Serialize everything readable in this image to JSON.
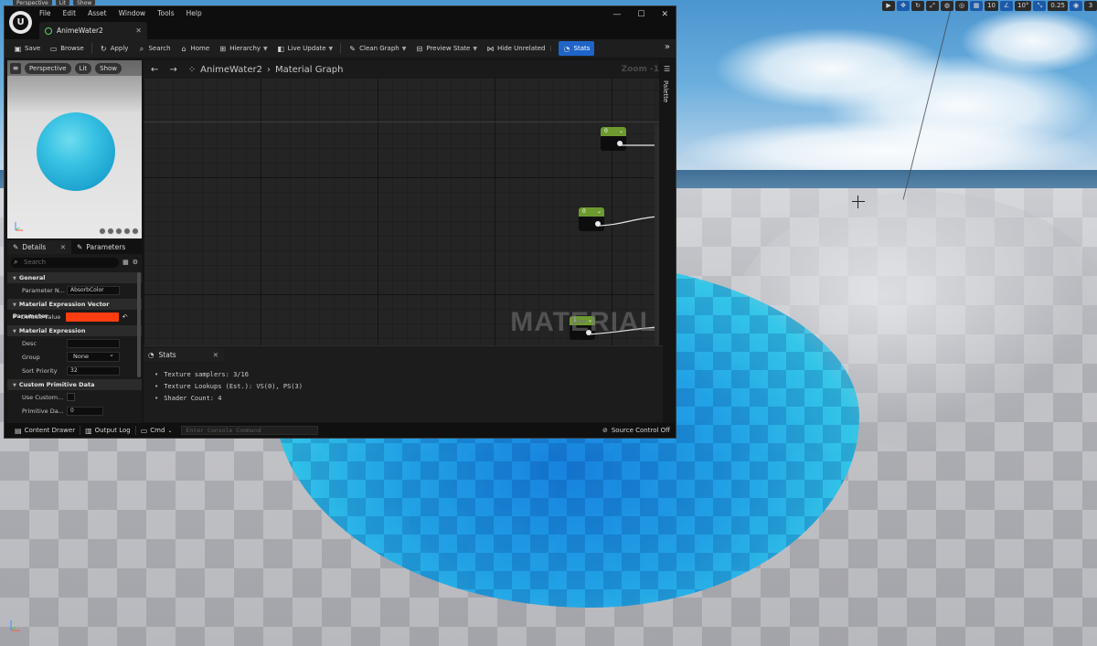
{
  "viewport": {
    "top_left_buttons": [
      "Perspective",
      "Lit",
      "Show"
    ],
    "top_right_buttons": [
      "10",
      "10°",
      "0.25",
      "3"
    ]
  },
  "editor": {
    "menu": [
      "File",
      "Edit",
      "Asset",
      "Window",
      "Tools",
      "Help"
    ],
    "doc_tab": "AnimeWater2",
    "window_controls": [
      "—",
      "☐",
      "✕"
    ],
    "toolbar": {
      "save": "Save",
      "browse": "Browse",
      "apply": "Apply",
      "search": "Search",
      "home": "Home",
      "hierarchy": "Hierarchy",
      "live_update": "Live Update",
      "clean_graph": "Clean Graph",
      "preview_state": "Preview State",
      "hide_unrelated": "Hide Unrelated",
      "stats": "Stats"
    },
    "preview": {
      "buttons": [
        "Perspective",
        "Lit",
        "Show"
      ]
    },
    "details": {
      "tab_details": "Details",
      "tab_parameters": "Parameters",
      "search_placeholder": "Search",
      "sections": {
        "general": "General",
        "vector_param": "Material Expression Vector Parameter",
        "expression": "Material Expression",
        "custom_primitive": "Custom Primitive Data"
      },
      "rows": {
        "parameter_name_label": "Parameter N...",
        "parameter_name_value": "AbsorbColor",
        "default_value_label": "Default Value",
        "desc_label": "Desc",
        "group_label": "Group",
        "group_value": "None",
        "sort_priority_label": "Sort Priority",
        "sort_priority_value": "32",
        "use_custom_label": "Use Custom...",
        "primitive_data_label": "Primitive Da...",
        "primitive_data_value": "0"
      },
      "default_color": "#ff3d10"
    },
    "graph": {
      "breadcrumb_asset": "AnimeWater2",
      "breadcrumb_graph": "Material Graph",
      "zoom": "Zoom -1",
      "watermark": "MATERIAL",
      "palette": "Palette",
      "nodes": [
        "0",
        "0",
        "1"
      ]
    },
    "stats": {
      "tab": "Stats",
      "lines": [
        "Texture samplers: 3/16",
        "Texture Lookups (Est.): VS(0), PS(3)",
        "Shader Count: 4"
      ]
    },
    "statusbar": {
      "content_drawer": "Content Drawer",
      "output_log": "Output Log",
      "cmd": "Cmd",
      "console_placeholder": "Enter Console Command",
      "source_control": "Source Control Off"
    }
  }
}
